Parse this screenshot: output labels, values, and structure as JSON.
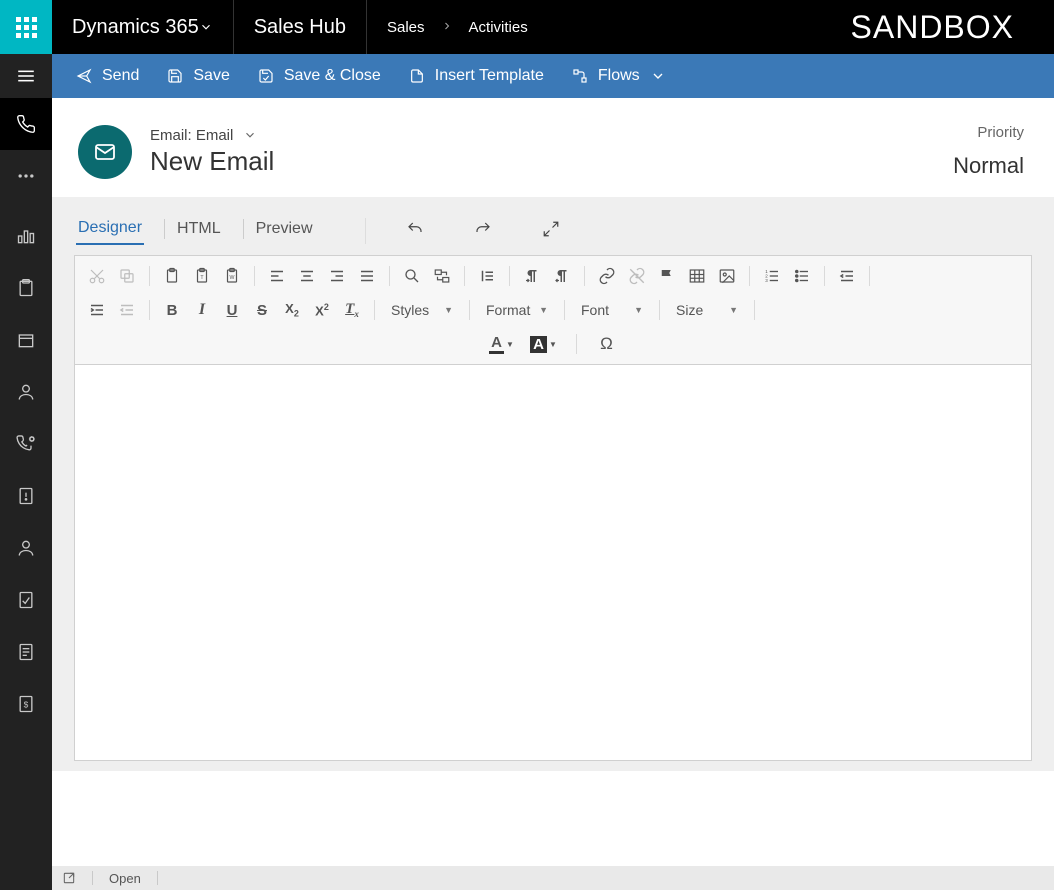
{
  "topbar": {
    "brand": "Dynamics 365",
    "hub": "Sales Hub",
    "crumb_root": "Sales",
    "crumb_leaf": "Activities",
    "sandbox": "SANDBOX"
  },
  "commands": {
    "send": "Send",
    "save": "Save",
    "save_close": "Save & Close",
    "insert_template": "Insert Template",
    "flows": "Flows"
  },
  "record": {
    "type_line": "Email: Email",
    "title": "New Email",
    "priority_label": "Priority",
    "priority_value": "Normal"
  },
  "editor_tabs": {
    "designer": "Designer",
    "html": "HTML",
    "preview": "Preview"
  },
  "rte_dropdowns": {
    "styles": "Styles",
    "format": "Format",
    "font": "Font",
    "size": "Size"
  },
  "footer": {
    "open": "Open"
  },
  "icons": {
    "send": "send-icon",
    "save": "save-icon",
    "save_close": "save-close-icon",
    "template": "template-icon",
    "flow": "flow-icon",
    "email": "email-icon"
  }
}
